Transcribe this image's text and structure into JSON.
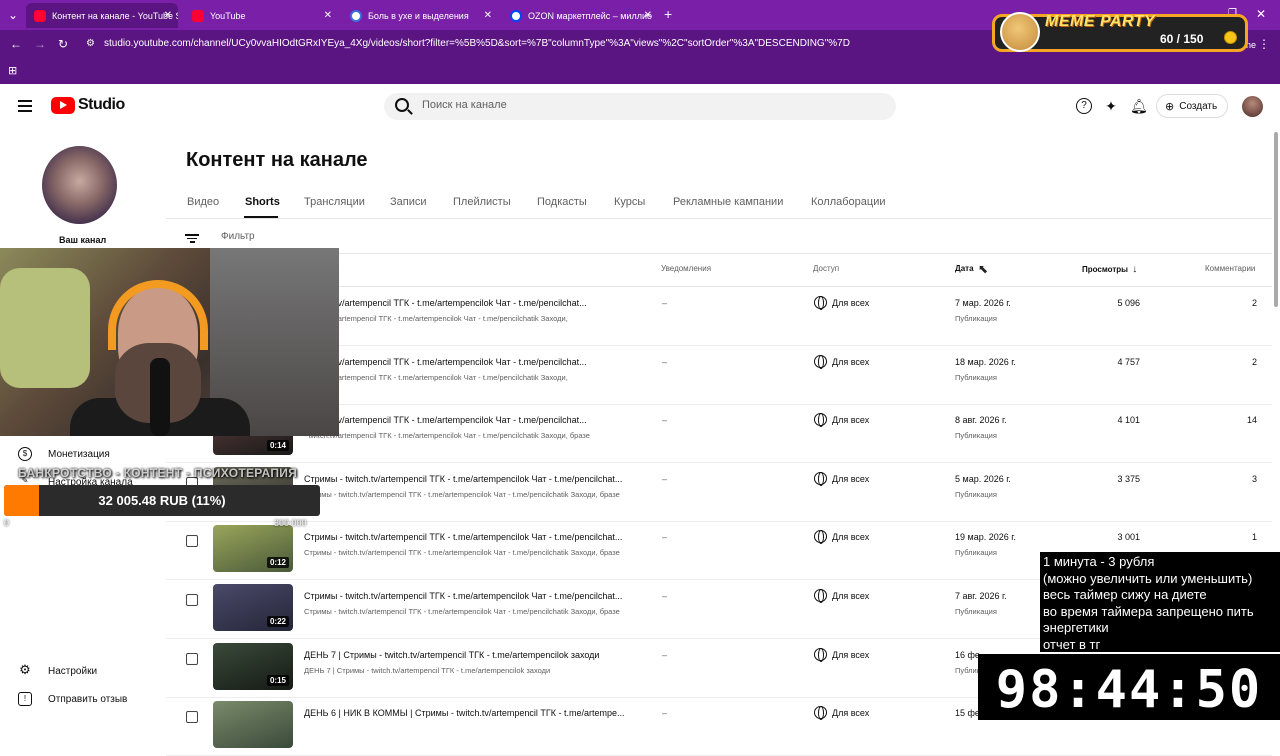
{
  "browser": {
    "tabs": [
      {
        "label": "Контент на канале - YouTube S",
        "favicon": "youtube",
        "active": true
      },
      {
        "label": "YouTube",
        "favicon": "youtube",
        "active": false
      },
      {
        "label": "Боль в ухе и выделения",
        "favicon": "doc",
        "active": false
      },
      {
        "label": "OZON маркетплейс – миллио",
        "favicon": "ozon",
        "active": false
      }
    ],
    "url": "studio.youtube.com/channel/UCy0vvaHIOdtGRxIYEya_4Xg/videos/short?filter=%5B%5D&sort=%7B\"columnType\"%3A\"views\"%2C\"sortOrder\"%3A\"DESCENDING\"%7D",
    "bookmarks_label": "ne"
  },
  "meme_party": {
    "title": "MEME PARTY",
    "count": "60 / 150"
  },
  "studio": {
    "logo_text": "Studio",
    "search_placeholder": "Поиск на канале",
    "create_label": "Создать"
  },
  "sidebar": {
    "channel_label": "Ваш канал",
    "items": [
      {
        "label": "Монетизация",
        "icon": "dollar-icon"
      },
      {
        "label": "Настройка канала",
        "icon": "brush-icon"
      },
      {
        "label": "Настройки",
        "icon": "gear-icon"
      },
      {
        "label": "Отправить отзыв",
        "icon": "feedback-icon"
      }
    ]
  },
  "main": {
    "title": "Контент на канале",
    "tabs": [
      "Видео",
      "Shorts",
      "Трансляции",
      "Записи",
      "Плейлисты",
      "Подкасты",
      "Курсы",
      "Рекламные кампании",
      "Коллаборации"
    ],
    "active_tab": "Shorts",
    "filter_placeholder": "Фильтр",
    "columns": {
      "notifications": "Уведомления",
      "access": "Доступ",
      "date": "Дата",
      "views": "Просмотры",
      "comments": "Комментарии"
    },
    "rows": [
      {
        "title": "- twitch.tv/artempencil ТГК - t.me/artempencilok Чат - t.me/pencilchat...",
        "desc": "- twitch.tv/artempencil ТГК - t.me/artempencilok Чат - t.me/pencilchatik Заходи,",
        "duration": "",
        "notif": "–",
        "access": "Для всех",
        "date": "7 мар. 2026 г.",
        "status": "Публикация",
        "views": "5 096",
        "comments": "2"
      },
      {
        "title": "- twitch.tv/artempencil ТГК - t.me/artempencilok Чат - t.me/pencilchat...",
        "desc": "- twitch.tv/artempencil ТГК - t.me/artempencilok Чат - t.me/pencilchatik Заходи,",
        "duration": "",
        "notif": "–",
        "access": "Для всех",
        "date": "18 мар. 2026 г.",
        "status": "Публикация",
        "views": "4 757",
        "comments": "2"
      },
      {
        "title": "- twitch.tv/artempencil ТГК - t.me/artempencilok Чат - t.me/pencilchat...",
        "desc": "- twitch.tv/artempencil ТГК - t.me/artempencilok Чат - t.me/pencilchatik Заходи, бразе",
        "duration": "0:14",
        "notif": "–",
        "access": "Для всех",
        "date": "8 авг. 2026 г.",
        "status": "Публикация",
        "views": "4 101",
        "comments": "14"
      },
      {
        "title": "Стримы - twitch.tv/artempencil ТГК - t.me/artempencilok Чат - t.me/pencilchat...",
        "desc": "Стримы - twitch.tv/artempencil ТГК - t.me/artempencilok Чат - t.me/pencilchatik Заходи, бразе",
        "duration": "",
        "notif": "–",
        "access": "Для всех",
        "date": "5 мар. 2026 г.",
        "status": "Публикация",
        "views": "3 375",
        "comments": "3"
      },
      {
        "title": "Стримы - twitch.tv/artempencil ТГК - t.me/artempencilok Чат - t.me/pencilchat...",
        "desc": "Стримы - twitch.tv/artempencil ТГК - t.me/artempencilok Чат - t.me/pencilchatik Заходи, бразе",
        "duration": "0:12",
        "notif": "–",
        "access": "Для всех",
        "date": "19 мар. 2026 г.",
        "status": "Публикация",
        "views": "3 001",
        "comments": "1"
      },
      {
        "title": "Стримы - twitch.tv/artempencil ТГК - t.me/artempencilok Чат - t.me/pencilchat...",
        "desc": "Стримы - twitch.tv/artempencil ТГК - t.me/artempencilok Чат - t.me/pencilchatik Заходи, бразе",
        "duration": "0:22",
        "notif": "–",
        "access": "Для всех",
        "date": "7 авг. 2026 г.",
        "status": "Публикация",
        "views": "",
        "comments": ""
      },
      {
        "title": "ДЕНЬ 7 | Стримы - twitch.tv/artempencil ТГК - t.me/artempencilok заходи",
        "desc": "ДЕНЬ 7 | Стримы - twitch.tv/artempencil ТГК - t.me/artempencilok заходи",
        "duration": "0:15",
        "notif": "–",
        "access": "Для всех",
        "date": "16 фе",
        "status": "Публикация",
        "views": "",
        "comments": ""
      },
      {
        "title": "ДЕНЬ 6 | НИК В КОММЫ | Стримы - twitch.tv/artempencil ТГК - t.me/artempe...",
        "desc": "",
        "duration": "",
        "notif": "–",
        "access": "Для всех",
        "date": "15 фе",
        "status": "",
        "views": "",
        "comments": ""
      }
    ]
  },
  "overlay": {
    "banner": "БАНКРОТСТВО - КОНТЕНТ - ПСИХОТЕРАПИЯ",
    "goal_text": "32 005.48 RUB (11%)",
    "goal_progress": 0.11,
    "goal_target": "300 000",
    "goal_zero": "0",
    "timer_info": [
      "1 минута - 3 рубля",
      "(можно увеличить или уменьшить)",
      "весь таймер сижу на диете",
      "во время таймера запрещено пить",
      "энергетики",
      "отчет в тг"
    ],
    "timer": "98:44:50"
  },
  "colors": {
    "browser_purple": "#7a1fa8",
    "youtube_red": "#ff0000",
    "goal_orange": "#ff7a00"
  }
}
